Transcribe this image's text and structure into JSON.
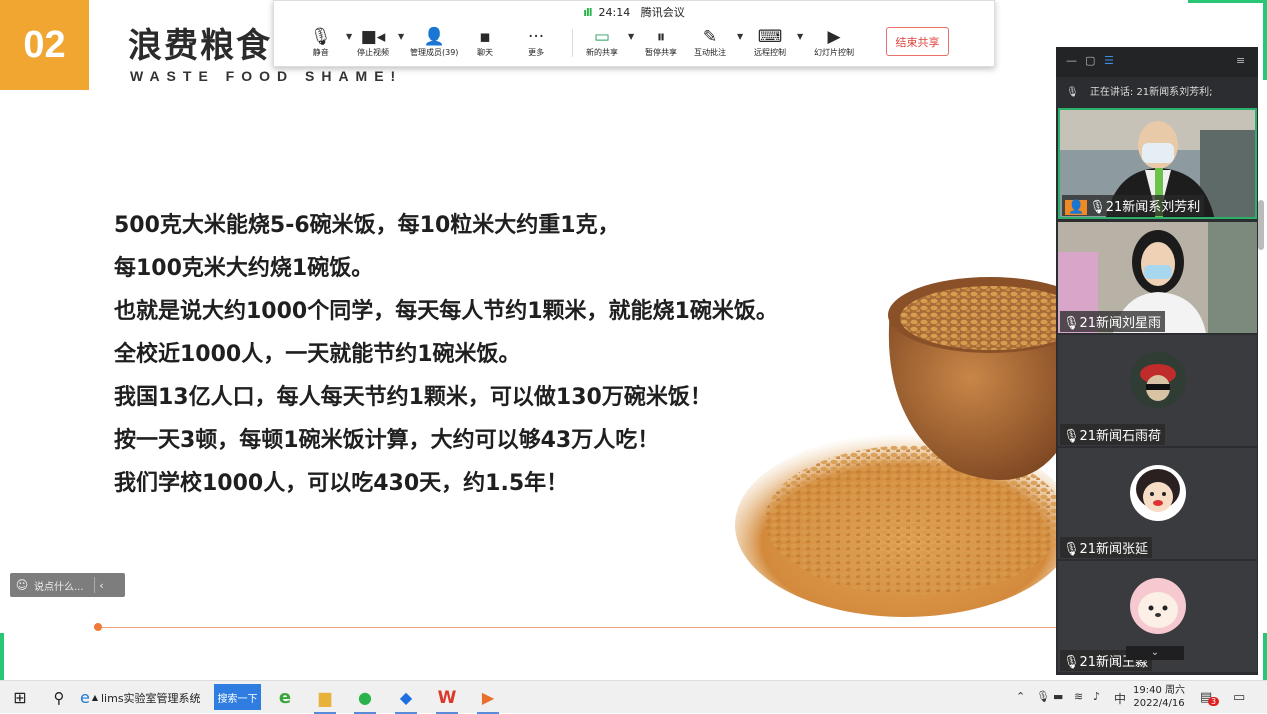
{
  "slide": {
    "badge": "02",
    "title": "浪费粮食",
    "subtitle": "WASTE FOOD SHAME!",
    "lines": [
      "500克大米能烧5-6碗米饭，每10粒米大约重1克，",
      "每100克米大约烧1碗饭。",
      "也就是说大约1000个同学，每天每人节约1颗米，就能烧1碗米饭。",
      "全校近1000人，一天就能节约1碗米饭。",
      "我国13亿人口，每人每天节约1颗米，可以做130万碗米饭！",
      "按一天3顿，每顿1碗米饭计算，大约可以够43万人吃！",
      "我们学校1000人，可以吃430天，约1.5年！"
    ],
    "comment_placeholder": "说点什么..."
  },
  "toolbar": {
    "time": "24:14",
    "app_name": "腾讯会议",
    "buttons": {
      "mute": "静音",
      "stop_video": "停止视频",
      "manage_members": "管理成员(39)",
      "chat": "聊天",
      "more": "更多",
      "new_share": "新的共享",
      "pause_share": "暂停共享",
      "annotate": "互动批注",
      "remote_control": "远程控制",
      "slide_control": "幻灯片控制"
    },
    "end_share": "结束共享"
  },
  "panel": {
    "speaking": "正在讲话: 21新闻系刘芳利;",
    "participants": [
      {
        "name": "21新闻系刘芳利"
      },
      {
        "name": "21新闻刘星雨"
      },
      {
        "name": "21新闻石雨荷"
      },
      {
        "name": "21新闻张延"
      },
      {
        "name": "21新闻王淼"
      }
    ]
  },
  "taskbar": {
    "browser_label": "lims实验室管理系统",
    "search_label": "搜索一下",
    "ime": "中",
    "clock_time": "19:40 周六",
    "clock_date": "2022/4/16",
    "notification_count": "3"
  },
  "colors": {
    "badge": "#f0a631",
    "accent_green": "#28c776",
    "end_share": "#e0443e",
    "search_blue": "#2f7de1"
  }
}
